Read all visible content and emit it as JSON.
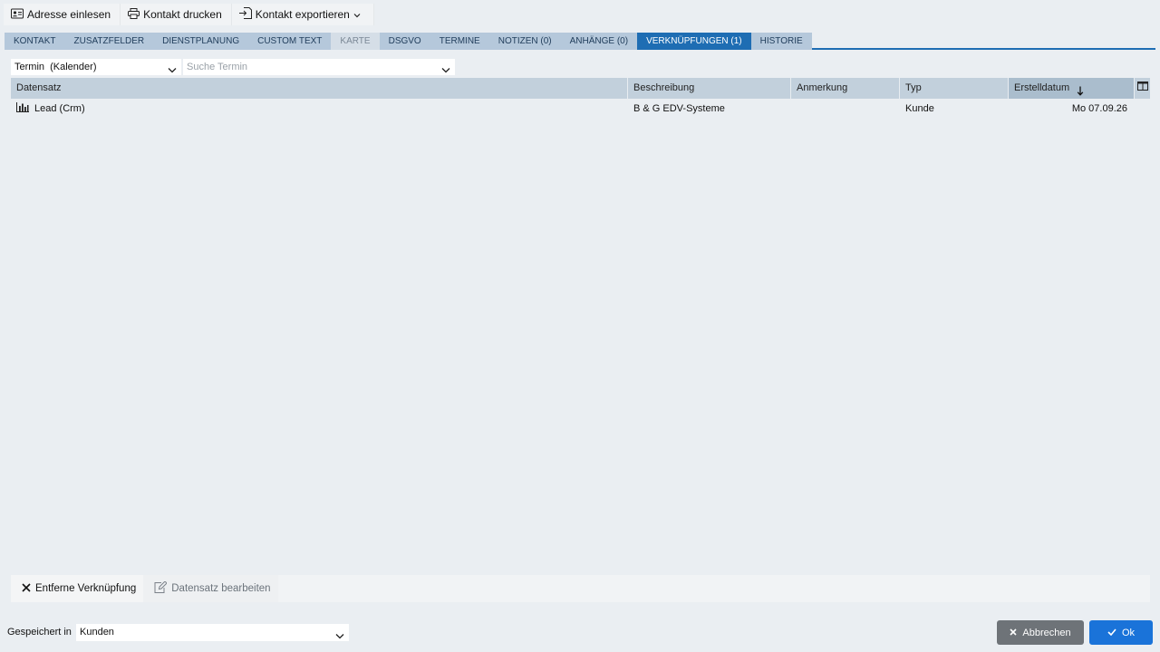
{
  "toolbar": {
    "read_address_label": "Adresse einlesen",
    "print_contact_label": "Kontakt drucken",
    "export_contact_label": "Kontakt exportieren"
  },
  "tabs": [
    {
      "label": "KONTAKT",
      "state": "normal"
    },
    {
      "label": "ZUSATZFELDER",
      "state": "normal"
    },
    {
      "label": "DIENSTPLANUNG",
      "state": "normal"
    },
    {
      "label": "CUSTOM TEXT",
      "state": "normal"
    },
    {
      "label": "KARTE",
      "state": "disabled"
    },
    {
      "label": "DSGVO",
      "state": "normal"
    },
    {
      "label": "TERMINE",
      "state": "normal"
    },
    {
      "label": "NOTIZEN (0)",
      "state": "normal"
    },
    {
      "label": "ANHÄNGE (0)",
      "state": "normal"
    },
    {
      "label": "VERKNÜPFUNGEN (1)",
      "state": "active"
    },
    {
      "label": "HISTORIE",
      "state": "normal"
    }
  ],
  "filter": {
    "type_value": "Termin  (Kalender)",
    "search_placeholder": "Suche Termin"
  },
  "grid": {
    "columns": {
      "record": "Datensatz",
      "description": "Beschreibung",
      "remark": "Anmerkung",
      "type": "Typ",
      "created": "Erstelldatum"
    },
    "sorted_column": "Erstelldatum",
    "sort_direction": "descending",
    "rows": [
      {
        "record": "Lead (Crm)",
        "icon": "bar-chart-icon",
        "description": "B & G EDV-Systeme",
        "remark": "",
        "type": "Kunde",
        "created": "Mo 07.09.26"
      }
    ]
  },
  "actions": {
    "remove_link_label": "Entferne Verknüpfung",
    "edit_record_label": "Datensatz bearbeiten"
  },
  "footer": {
    "saved_in_label": "Gespeichert in",
    "saved_in_value": "Kunden",
    "cancel_label": "Abbrechen",
    "ok_label": "Ok"
  },
  "colors": {
    "accent": "#1e6db3",
    "ok_button": "#1a73d9",
    "cancel_button": "#6e7378",
    "tab_background": "#b5c8db"
  }
}
